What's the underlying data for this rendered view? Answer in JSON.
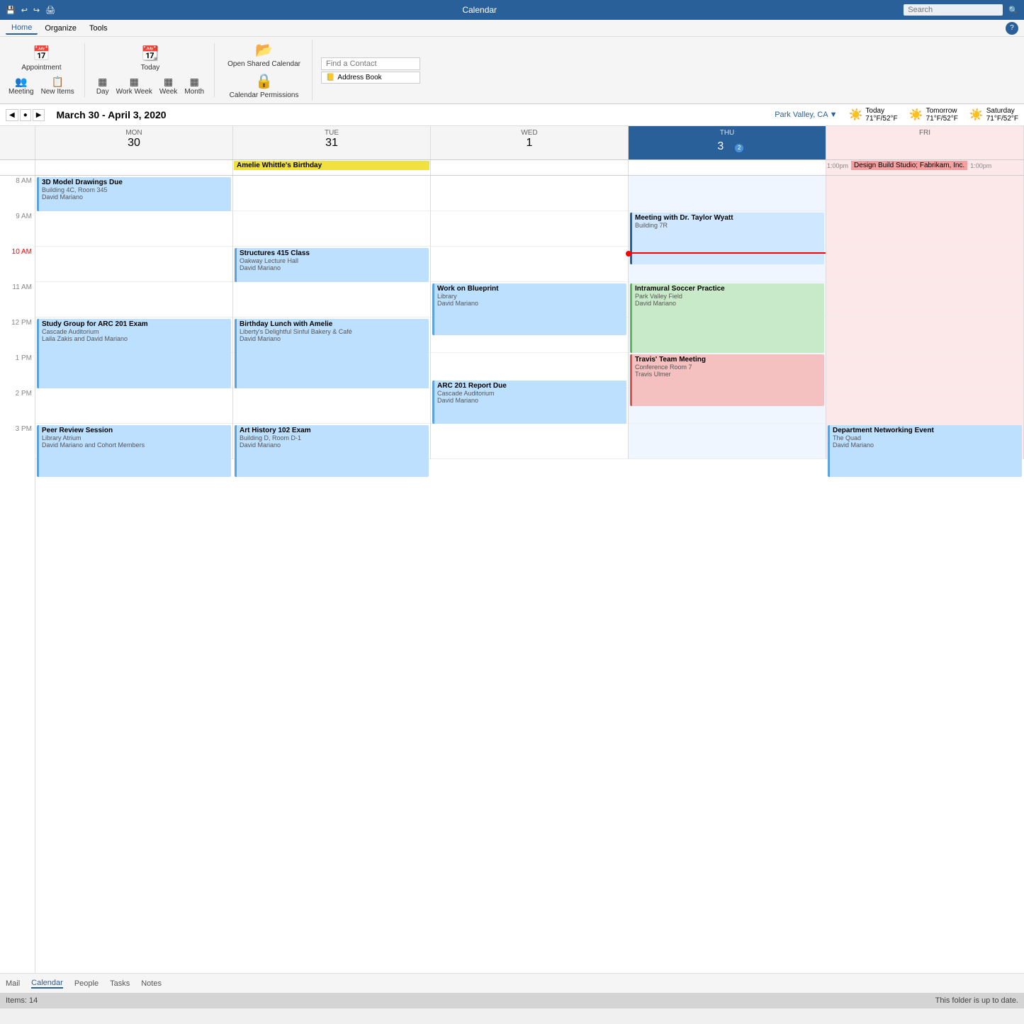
{
  "titleBar": {
    "title": "Calendar",
    "searchPlaceholder": "Search"
  },
  "menuBar": {
    "items": [
      "Home",
      "Organize",
      "Tools"
    ]
  },
  "ribbon": {
    "groups": [
      {
        "buttons": [
          {
            "label": "Appointment",
            "icon": "📅"
          },
          {
            "label": "Meeting",
            "icon": "👥"
          },
          {
            "label": "New Items",
            "icon": "📋"
          }
        ]
      },
      {
        "buttons": [
          {
            "label": "Today",
            "icon": "📆"
          },
          {
            "label": "Day",
            "icon": "▦"
          },
          {
            "label": "Work Week",
            "icon": "▦▦"
          },
          {
            "label": "Week",
            "icon": "▦▦▦"
          },
          {
            "label": "Month",
            "icon": "▦▦▦▦"
          }
        ]
      },
      {
        "buttons": [
          {
            "label": "Open Shared Calendar",
            "icon": "📂"
          },
          {
            "label": "Calendar Permissions",
            "icon": "🔒"
          }
        ]
      },
      {
        "contactInput": {
          "placeholder": "Find a Contact"
        },
        "addressBtn": "Address Book"
      }
    ]
  },
  "weather": {
    "location": "Park Valley, CA",
    "today": {
      "label": "Today",
      "temp": "71°F/52°F",
      "emoji": "☀️"
    },
    "tomorrow": {
      "label": "Tomorrow",
      "temp": "71°F/52°F",
      "emoji": "☀️"
    },
    "saturday": {
      "label": "Saturday",
      "temp": "71°F/52°F",
      "emoji": "☀️"
    }
  },
  "dateRange": "March 30 - April 3, 2020",
  "calendarHeader": {
    "timeCol": "",
    "days": [
      {
        "name": "Monday",
        "num": "30",
        "isToday": false
      },
      {
        "name": "Tuesday",
        "num": "31",
        "isToday": false
      },
      {
        "name": "Wednesday",
        "num": "1",
        "isToday": false
      },
      {
        "name": "Thursday",
        "num": "3",
        "isToday": true
      },
      {
        "name": "Friday",
        "num": "",
        "isToday": false
      }
    ]
  },
  "allDayEvents": {
    "monday": [],
    "tuesday": [
      {
        "text": "Amelie Whittle's Birthday",
        "type": "yellow"
      }
    ],
    "wednesday": [],
    "thursday": [],
    "friday": [
      {
        "text": "Design Build Studio; Fabrikam, Inc.",
        "time": "1:00pm",
        "type": "pink"
      }
    ]
  },
  "events": [
    {
      "day": 0,
      "title": "3D Model Drawings Due",
      "sub1": "Building 4C, Room 345",
      "sub2": "David Mariano",
      "startHour": 8,
      "startMin": 0,
      "endHour": 9,
      "endMin": 0,
      "type": "blue"
    },
    {
      "day": 1,
      "title": "Structures 415 Class",
      "sub1": "Oakway Lecture Hall",
      "sub2": "David Mariano",
      "startHour": 10,
      "startMin": 0,
      "endHour": 11,
      "endMin": 0,
      "type": "blue"
    },
    {
      "day": 0,
      "title": "Study Group for ARC 201 Exam",
      "sub1": "Cascade Auditorium",
      "sub2": "Laila Zakis and David Mariano",
      "startHour": 12,
      "startMin": 0,
      "endHour": 14,
      "endMin": 0,
      "type": "blue"
    },
    {
      "day": 1,
      "title": "Birthday Lunch with Amelie",
      "sub1": "Liberty's Delightful Sinful Bakery & Café",
      "sub2": "David Mariano",
      "startHour": 12,
      "startMin": 0,
      "endHour": 14,
      "endMin": 0,
      "type": "blue"
    },
    {
      "day": 0,
      "title": "Peer Review Session",
      "sub1": "Library Atrium",
      "sub2": "David Mariano and Cohort Members",
      "startHour": 15,
      "startMin": 0,
      "endHour": 16,
      "endMin": 30,
      "type": "blue"
    },
    {
      "day": 1,
      "title": "Art History 102 Exam",
      "sub1": "Building D, Room D-1",
      "sub2": "David Mariano",
      "startHour": 15,
      "startMin": 0,
      "endHour": 16,
      "endMin": 30,
      "type": "blue"
    },
    {
      "day": 2,
      "title": "Work on Blueprint",
      "sub1": "Library",
      "sub2": "David Mariano",
      "startHour": 11,
      "startMin": 0,
      "endHour": 12,
      "endMin": 30,
      "type": "blue"
    },
    {
      "day": 2,
      "title": "ARC 201 Report Due",
      "sub1": "Cascade Auditorium",
      "sub2": "David Mariano",
      "startHour": 14,
      "startMin": 45,
      "endHour": 16,
      "endMin": 0,
      "type": "blue"
    },
    {
      "day": 3,
      "title": "Meeting with Dr. Taylor Wyatt",
      "sub1": "Building 7R",
      "sub2": "",
      "startHour": 9,
      "startMin": 0,
      "endHour": 10,
      "endMin": 30,
      "type": "today-blue"
    },
    {
      "day": 3,
      "title": "Intramural Soccer Practice",
      "sub1": "Park Valley Field",
      "sub2": "David Mariano",
      "startHour": 11,
      "startMin": 0,
      "endHour": 13,
      "endMin": 0,
      "type": "green"
    },
    {
      "day": 3,
      "title": "Travis' Team Meeting",
      "sub1": "Conference Room 7",
      "sub2": "Travis Ulmer",
      "startHour": 13,
      "startMin": 0,
      "endHour": 14,
      "endMin": 30,
      "type": "red"
    },
    {
      "day": 4,
      "title": "Department Networking Event",
      "sub1": "The Quad",
      "sub2": "David Mariano",
      "startHour": 15,
      "startMin": 0,
      "endHour": 16,
      "endMin": 30,
      "type": "blue"
    }
  ],
  "currentTime": {
    "hour": 10,
    "min": 10,
    "label": "10:10 AM"
  },
  "bottomNav": {
    "items": [
      "Mail",
      "Calendar",
      "People",
      "Tasks",
      "Notes"
    ]
  },
  "statusBar": {
    "items": "Items: 14",
    "status": "This folder is up to date."
  }
}
